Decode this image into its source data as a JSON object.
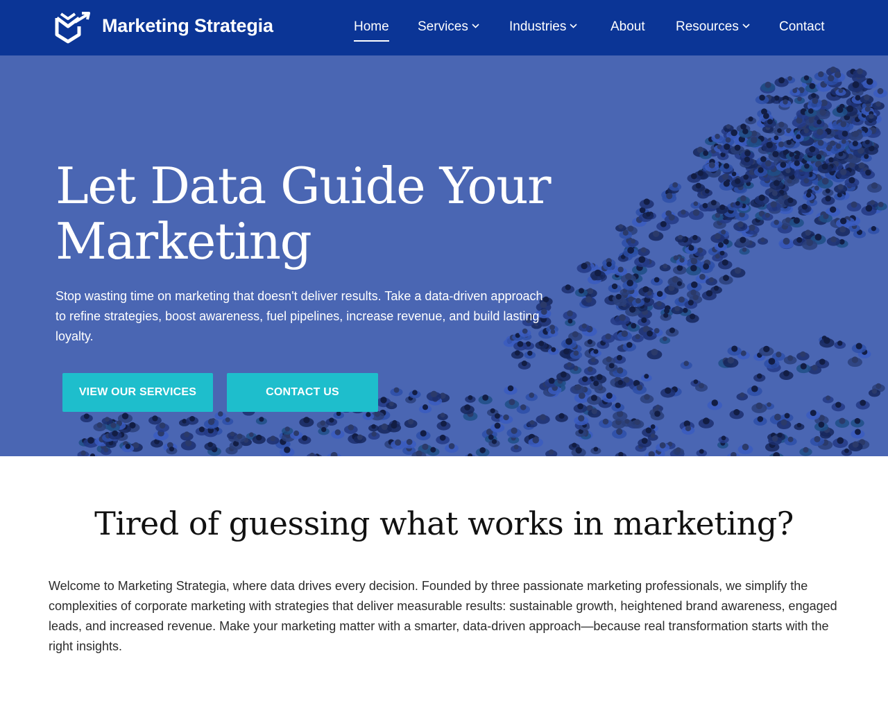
{
  "header": {
    "brand": "Marketing Strategia",
    "nav": [
      {
        "label": "Home",
        "active": true,
        "has_dropdown": false
      },
      {
        "label": "Services",
        "active": false,
        "has_dropdown": true
      },
      {
        "label": "Industries",
        "active": false,
        "has_dropdown": true
      },
      {
        "label": "About",
        "active": false,
        "has_dropdown": false
      },
      {
        "label": "Resources",
        "active": false,
        "has_dropdown": true
      },
      {
        "label": "Contact",
        "active": false,
        "has_dropdown": false
      }
    ]
  },
  "hero": {
    "title_line1": "Let Data Guide Your",
    "title_line2": "Marketing",
    "text": "Stop wasting time on marketing that doesn't deliver results. Take a data-driven approach to refine strategies, boost awareness, fuel pipelines, increase revenue, and build lasting loyalty.",
    "buttons": {
      "primary": "View Our Services",
      "secondary": "Contact Us"
    }
  },
  "intro": {
    "title": "Tired of guessing what works in marketing?",
    "text": "Welcome to Marketing Strategia, where data drives every decision. Founded by three passionate marketing professionals, we simplify the complexities of corporate marketing with strategies that deliver measurable results: sustainable growth, heightened brand awareness, engaged leads, and increased revenue. Make your marketing matter with a smarter, data-driven approach—because real transformation starts with the right insights."
  },
  "icons": {
    "logo": "brand-logo-icon",
    "dropdown": "chevron-down-icon"
  },
  "colors": {
    "header_bg": "#0b3596",
    "hero_bg": "#4a66b3",
    "button_bg": "#1ebecc",
    "crowd_dark": "#1c2f6e",
    "crowd_mid": "#2d4fa8"
  }
}
